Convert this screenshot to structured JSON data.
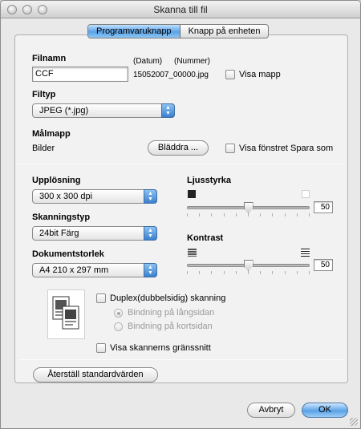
{
  "window": {
    "title": "Skanna till fil"
  },
  "tabs": [
    {
      "label": "Programvaruknapp",
      "active": true
    },
    {
      "label": "Knapp på enheten",
      "active": false
    }
  ],
  "filename": {
    "heading": "Filnamn",
    "value": "CCF",
    "date_hint": "(Datum)",
    "number_hint": "(Nummer)",
    "example": "15052007_00000.jpg",
    "show_folder_label": "Visa mapp"
  },
  "filetype": {
    "heading": "Filtyp",
    "selected": "JPEG (*.jpg)"
  },
  "destination": {
    "heading": "Målmapp",
    "folder": "Bilder",
    "browse_label": "Bläddra ...",
    "show_save_as_label": "Visa fönstret Spara som"
  },
  "resolution": {
    "heading": "Upplösning",
    "selected": "300 x 300 dpi"
  },
  "scan_type": {
    "heading": "Skanningstyp",
    "selected": "24bit Färg"
  },
  "doc_size": {
    "heading": "Dokumentstorlek",
    "selected": "A4  210 x 297 mm"
  },
  "brightness": {
    "heading": "Ljusstyrka",
    "value": "50",
    "fraction": 0.5
  },
  "contrast": {
    "heading": "Kontrast",
    "value": "50",
    "fraction": 0.5
  },
  "duplex": {
    "label": "Duplex(dubbelsidig) skanning",
    "long_edge": "Bindning på långsidan",
    "short_edge": "Bindning på kortsidan"
  },
  "scanner_interface_label": "Visa skannerns gränssnitt",
  "restore_defaults_label": "Återställ standardvärden",
  "cancel_label": "Avbryt",
  "ok_label": "OK",
  "colors": {
    "accent": "#5aa2e6",
    "panel": "#f2f2f2",
    "window": "#e9e9e9"
  }
}
